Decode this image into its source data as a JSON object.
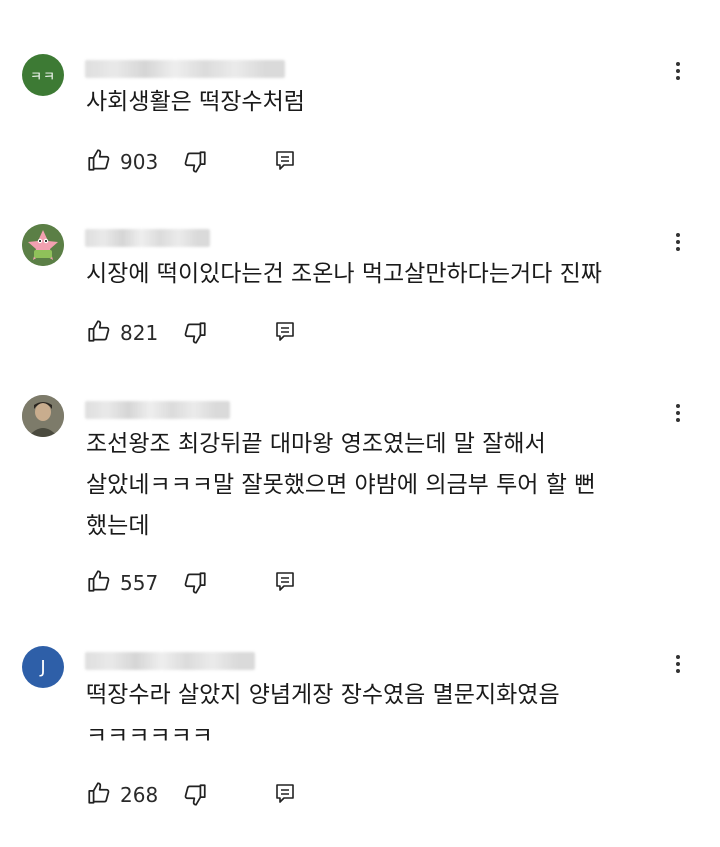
{
  "comments": [
    {
      "avatar": {
        "icon": "avatar-letters",
        "text": "ㅋㅋ",
        "color": "#3d7a34"
      },
      "text": "사회생활은 떡장수처럼",
      "likes": "903"
    },
    {
      "avatar": {
        "icon": "avatar-patrick-star",
        "color": "#5b7f46"
      },
      "text": "시장에 떡이있다는건 조온나 먹고살만하다는거다 진짜",
      "likes": "821"
    },
    {
      "avatar": {
        "icon": "avatar-photo",
        "color": "#6b6a5c"
      },
      "text": "조선왕조 최강뒤끝 대마왕 영조였는데 말 잘해서\n살았네ㅋㅋㅋ말 잘못했으면 야밤에 의금부 투어 할 뻔\n했는데",
      "likes": "557"
    },
    {
      "avatar": {
        "icon": "avatar-letter",
        "text": "J",
        "color": "#2e5fa8"
      },
      "text": "떡장수라 살았지 양념게장 장수였음 멸문지화였음\nㅋㅋㅋㅋㅋㅋ",
      "likes": "268"
    }
  ]
}
